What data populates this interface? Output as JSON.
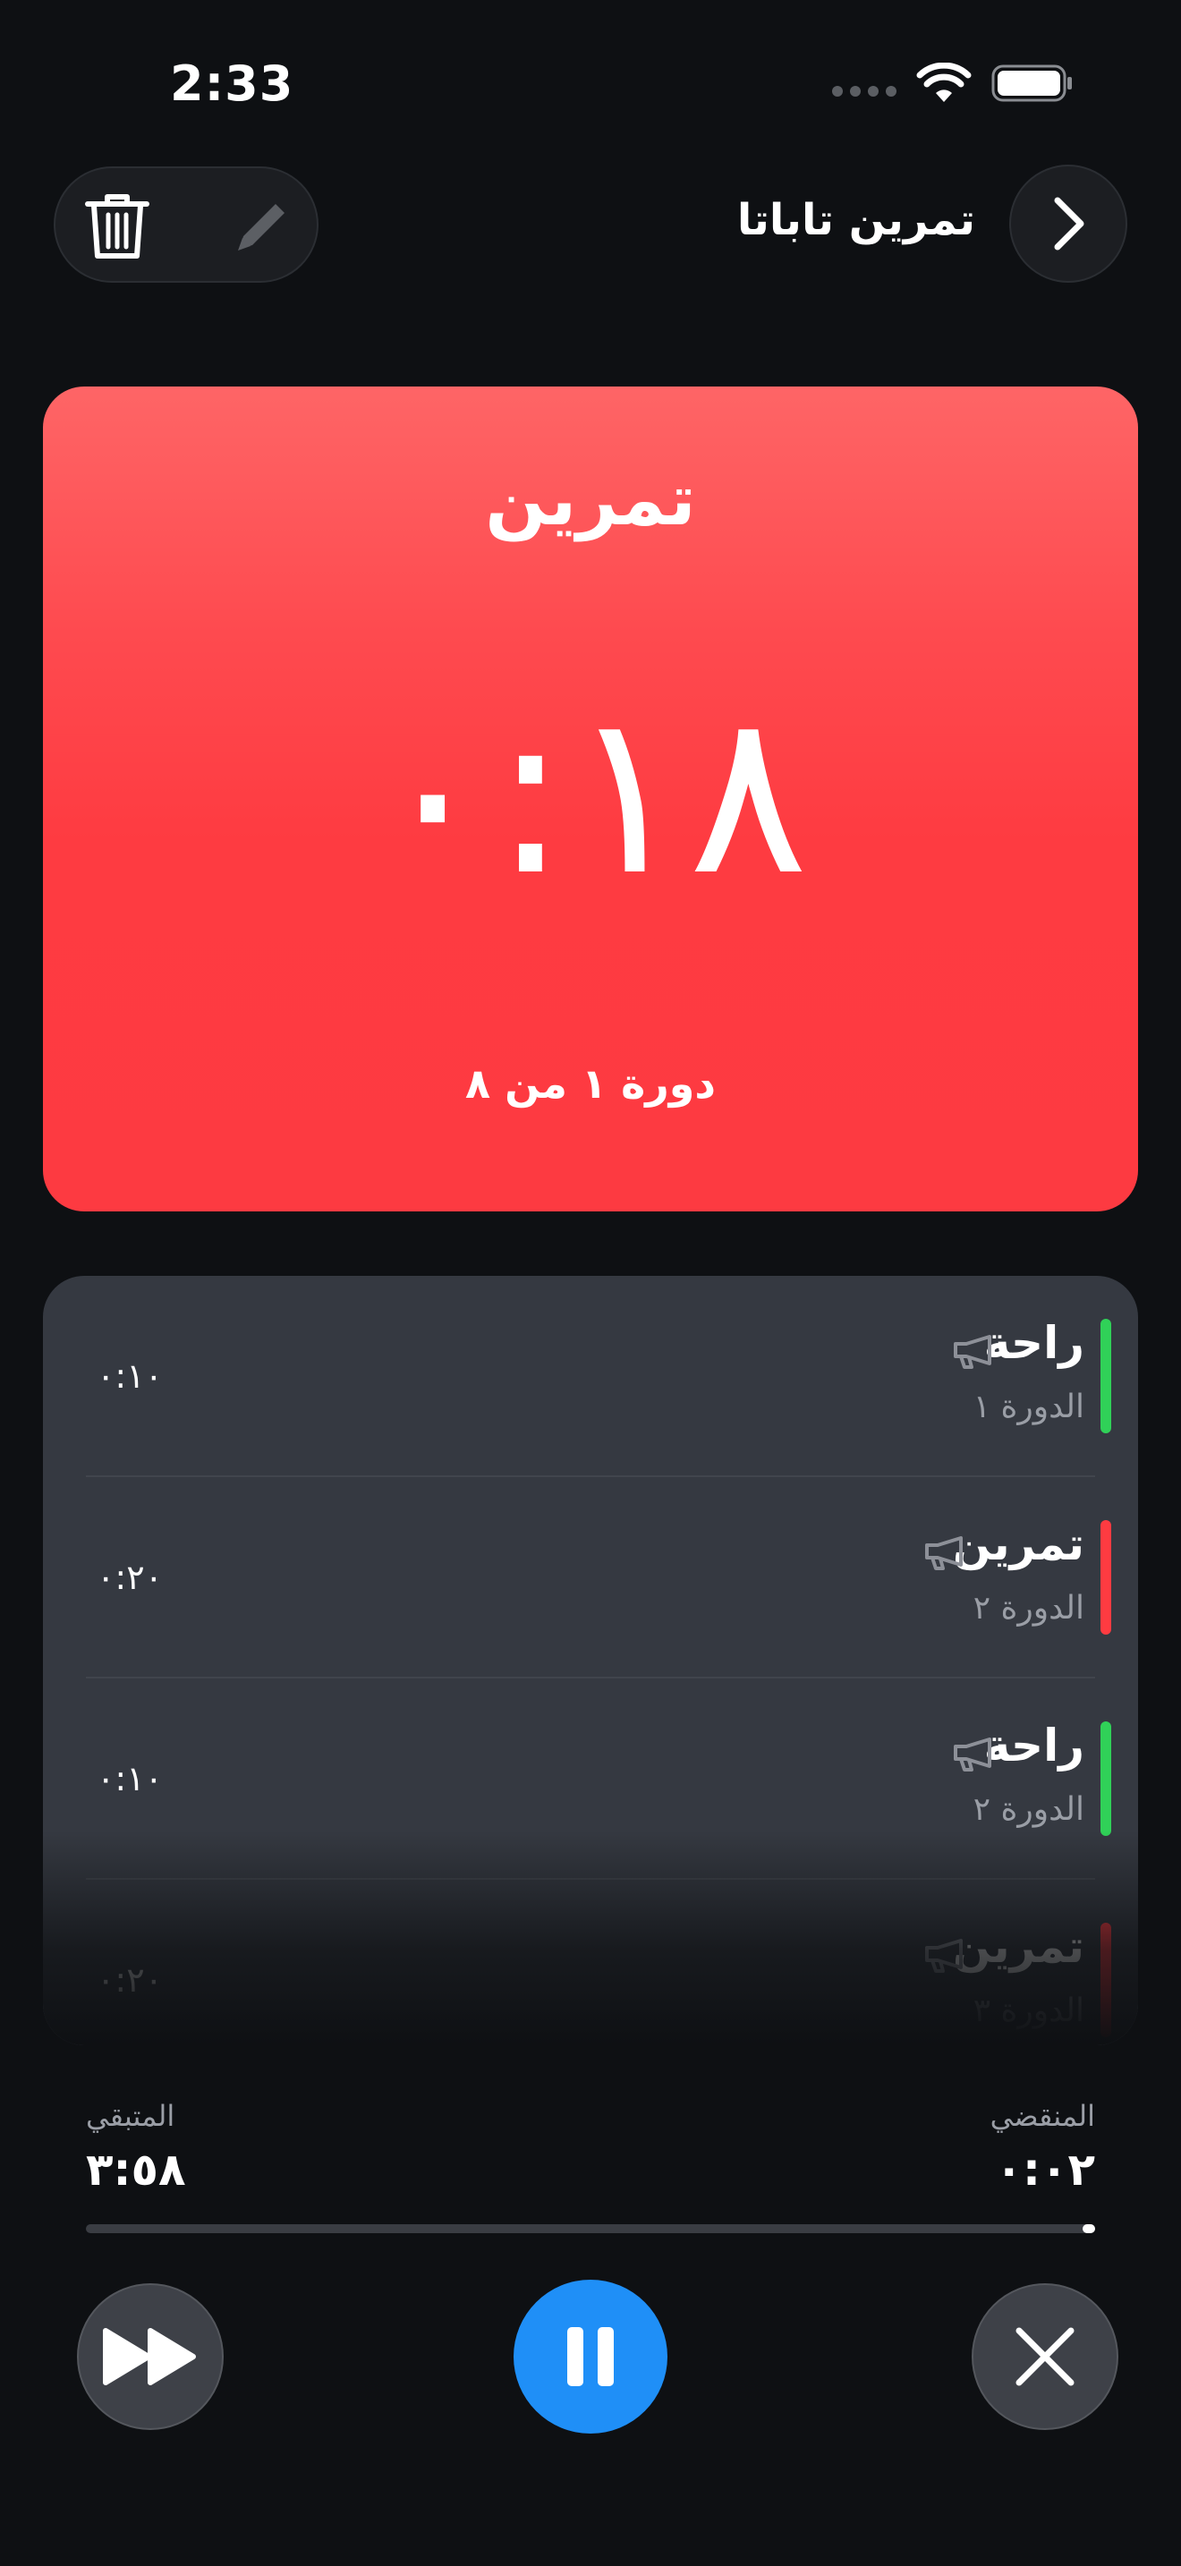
{
  "status_bar": {
    "time": "2:33"
  },
  "header": {
    "title": "تمرين تاباتا"
  },
  "timer": {
    "phase": "تمرين",
    "countdown": "٠:١٨",
    "round": "دورة ١ من ٨",
    "color": "#fe3b41"
  },
  "intervals": [
    {
      "name": "راحة",
      "round": "الدورة ١",
      "duration": "٠:١٠",
      "color": "#30d158"
    },
    {
      "name": "تمرين",
      "round": "الدورة ٢",
      "duration": "٠:٢٠",
      "color": "#fe3b41"
    },
    {
      "name": "راحة",
      "round": "الدورة ٢",
      "duration": "٠:١٠",
      "color": "#30d158"
    },
    {
      "name": "تمرين",
      "round": "الدورة ٣",
      "duration": "٠:٢٠",
      "color": "#fe3b41"
    }
  ],
  "stats": {
    "remaining_label": "المتبقي",
    "remaining_value": "٣:٥٨",
    "elapsed_label": "المنقضي",
    "elapsed_value": "٠:٠٢",
    "progress_fraction": 0.01
  },
  "icons": {
    "trash": "trash-icon",
    "edit": "pencil-icon",
    "next": "chevron-right-icon",
    "speaker": "megaphone-icon",
    "skip": "fast-forward-icon",
    "pause": "pause-icon",
    "close": "close-icon"
  },
  "colors": {
    "accent": "#1f8ff7",
    "work": "#fe3b41",
    "rest": "#30d158",
    "background": "#0e1013",
    "card": "#353941"
  }
}
